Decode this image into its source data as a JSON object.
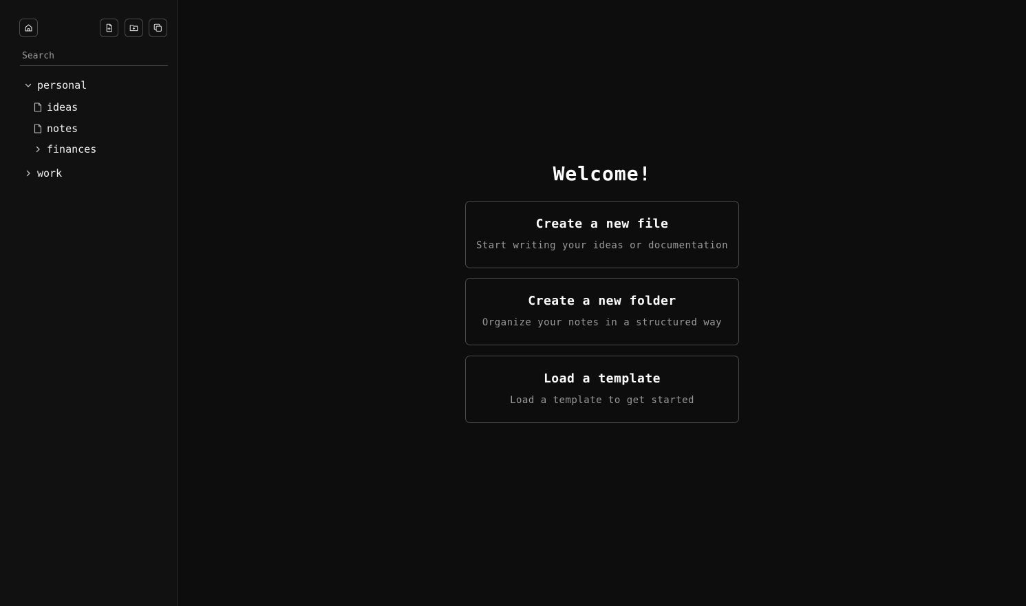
{
  "sidebar": {
    "toolbar": {
      "home_icon": "home-icon",
      "new_file_icon": "new-file-icon",
      "new_folder_icon": "new-folder-icon",
      "copy_icon": "copy-icon"
    },
    "search": {
      "placeholder": "Search",
      "value": ""
    },
    "tree": {
      "personal": {
        "label": "personal",
        "expanded": true
      },
      "ideas": {
        "label": "ideas"
      },
      "notes": {
        "label": "notes"
      },
      "finances": {
        "label": "finances",
        "expanded": false
      },
      "work": {
        "label": "work",
        "expanded": false
      }
    }
  },
  "main": {
    "welcome": "Welcome!",
    "cards": [
      {
        "title": "Create a new file",
        "desc": "Start writing your ideas or documentation"
      },
      {
        "title": "Create a new folder",
        "desc": "Organize your notes in a structured way"
      },
      {
        "title": "Load a template",
        "desc": "Load a template to get started"
      }
    ]
  },
  "colors": {
    "background": "#0d0d0d",
    "sidebar": "#111111",
    "border": "#4a4a4a",
    "text": "#f0f0f0",
    "muted": "#9a9a9a"
  }
}
